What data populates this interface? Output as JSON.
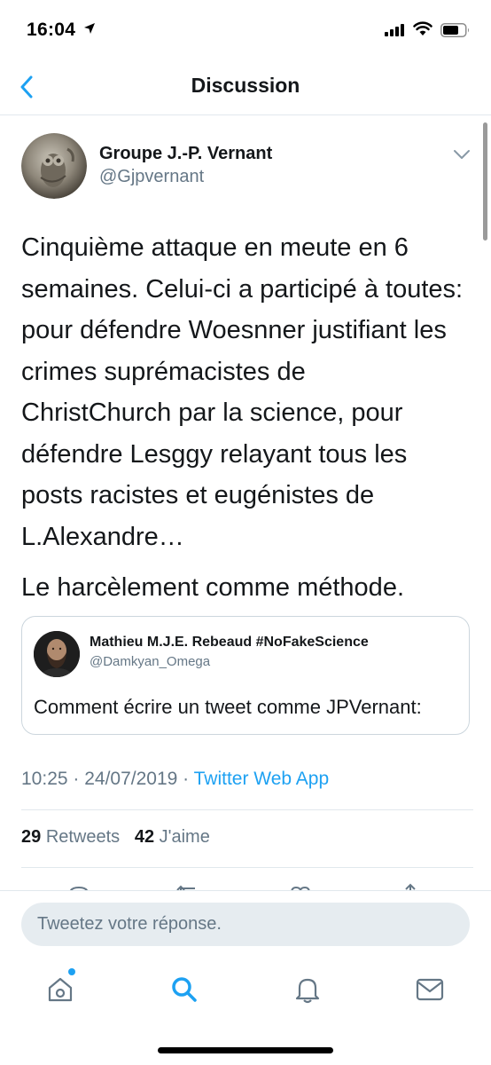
{
  "status_bar": {
    "time": "16:04"
  },
  "nav": {
    "title": "Discussion"
  },
  "tweet": {
    "author_name": "Groupe J.-P. Vernant",
    "author_handle": "@Gjpvernant",
    "text_paragraph_1": "Cinquième attaque en meute en 6\nsemaines. Celui-ci a participé à toutes:\npour défendre Woesnner justifiant les\ncrimes suprémacistes de\nChristChurch par la science, pour\ndéfendre Lesggy relayant tous les\nposts racistes et eugénistes de\nL.Alexandre…",
    "text_paragraph_2": "Le harcèlement comme méthode.",
    "timestamp": "10:25 · 24/07/2019 · ",
    "source": "Twitter Web App",
    "retweets_count": "29",
    "retweets_label": "Retweets",
    "likes_count": "42",
    "likes_label": "J'aime"
  },
  "quoted_tweet": {
    "author_name": "Mathieu M.J.E. Rebeaud #NoFakeScience",
    "author_handle": "@Damkyan_Omega",
    "text": "Comment écrire un tweet comme JPVernant:"
  },
  "reply": {
    "placeholder": "Tweetez votre réponse."
  },
  "tabs": [
    {
      "icon": "home-icon",
      "active": false,
      "has_notification": true
    },
    {
      "icon": "search-icon",
      "active": true
    },
    {
      "icon": "bell-icon",
      "active": false
    },
    {
      "icon": "mail-icon",
      "active": false
    }
  ],
  "colors": {
    "accent": "#1da1f2",
    "text_primary": "#14171a",
    "text_secondary": "#657786",
    "border": "#e1e8ed",
    "input_bg": "#e6ecf0"
  }
}
